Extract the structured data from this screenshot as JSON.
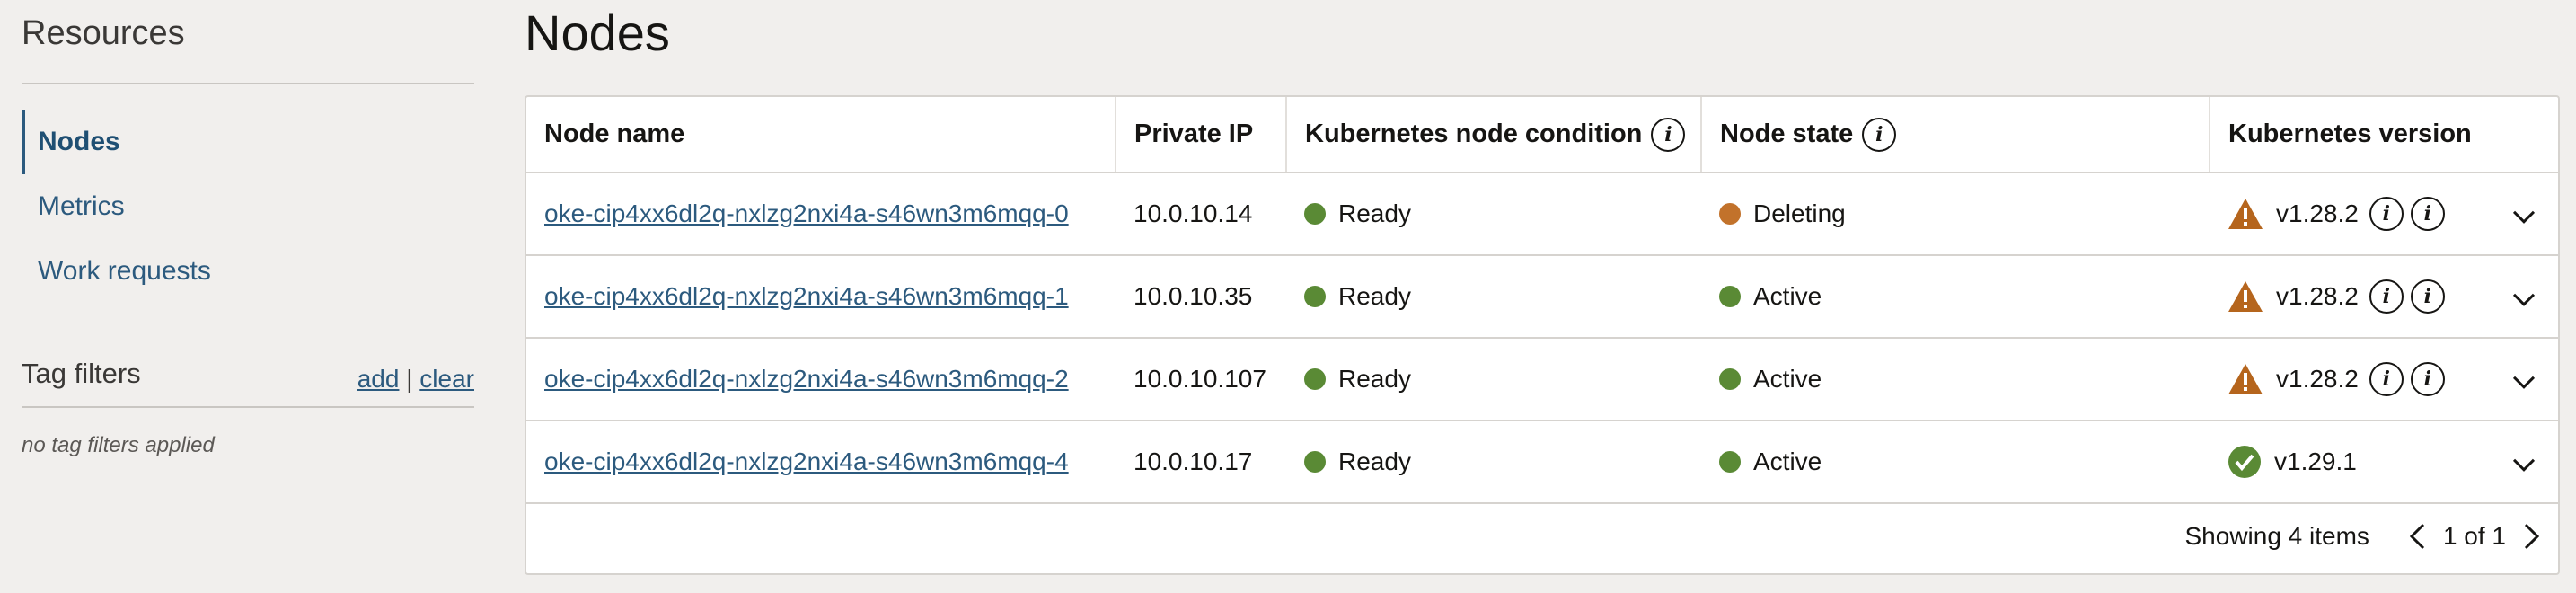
{
  "sidebar": {
    "title": "Resources",
    "nav": [
      {
        "label": "Nodes",
        "active": true
      },
      {
        "label": "Metrics",
        "active": false
      },
      {
        "label": "Work requests",
        "active": false
      }
    ],
    "tag_filters": {
      "title": "Tag filters",
      "add_label": "add",
      "separator": "|",
      "clear_label": "clear",
      "empty_text": "no tag filters applied"
    }
  },
  "main": {
    "title": "Nodes",
    "table": {
      "columns": [
        "Node name",
        "Private IP",
        "Kubernetes node condition",
        "Node state",
        "Kubernetes version"
      ],
      "rows": [
        {
          "name": "oke-cip4xx6dl2q-nxlzg2nxi4a-s46wn3m6mqq-0",
          "ip": "10.0.10.14",
          "condition": "Ready",
          "state": "Deleting",
          "version": "v1.28.2",
          "version_status": "warning"
        },
        {
          "name": "oke-cip4xx6dl2q-nxlzg2nxi4a-s46wn3m6mqq-1",
          "ip": "10.0.10.35",
          "condition": "Ready",
          "state": "Active",
          "version": "v1.28.2",
          "version_status": "warning"
        },
        {
          "name": "oke-cip4xx6dl2q-nxlzg2nxi4a-s46wn3m6mqq-2",
          "ip": "10.0.10.107",
          "condition": "Ready",
          "state": "Active",
          "version": "v1.28.2",
          "version_status": "warning"
        },
        {
          "name": "oke-cip4xx6dl2q-nxlzg2nxi4a-s46wn3m6mqq-4",
          "ip": "10.0.10.17",
          "condition": "Ready",
          "state": "Active",
          "version": "v1.29.1",
          "version_status": "ok"
        }
      ]
    },
    "footer": {
      "showing": "Showing 4 items",
      "page": "1 of 1"
    }
  },
  "colors": {
    "green": "#5a8a35",
    "orange": "#c2722b",
    "warning": "#b5651d",
    "link": "#2c5a7e"
  },
  "icons": {
    "info": "info-circle-icon",
    "warning": "warning-triangle-icon",
    "ok": "check-circle-icon",
    "expand": "chevron-down-icon"
  }
}
